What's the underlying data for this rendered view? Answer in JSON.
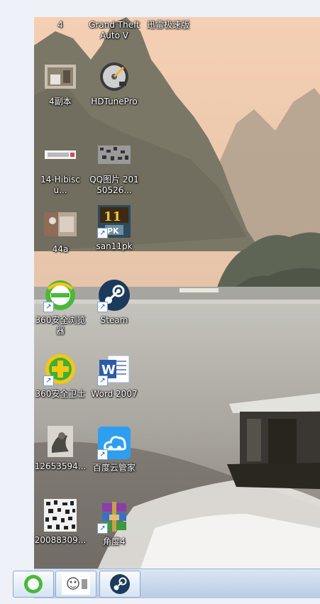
{
  "desktop": {
    "icons": [
      {
        "label": "4",
        "icon": "photo-icon"
      },
      {
        "label": "Grand Theft Auto V",
        "icon": "game-icon"
      },
      {
        "label": "迅雷极速版",
        "icon": "thunder-icon"
      },
      {
        "label": "4副本",
        "icon": "photo-icon"
      },
      {
        "label": "HDTunePro",
        "icon": "hard-disk-icon"
      },
      {
        "label": "14-Hibiscu...",
        "icon": "image-file-icon"
      },
      {
        "label": "QQ图片 20150526...",
        "icon": "image-file-icon"
      },
      {
        "label": "44a",
        "icon": "photo-icon"
      },
      {
        "label": "san11pk",
        "icon": "san11pk-icon"
      },
      {
        "label": "360安全浏览器",
        "icon": "browser-360-icon"
      },
      {
        "label": "Steam",
        "icon": "steam-icon"
      },
      {
        "label": "360安全卫士",
        "icon": "security-360-icon"
      },
      {
        "label": "Word 2007",
        "icon": "word-icon"
      },
      {
        "label": "12653594...",
        "icon": "photo-icon"
      },
      {
        "label": "百度云管家",
        "icon": "baidu-cloud-icon"
      },
      {
        "label": "20088309...",
        "icon": "image-file-icon"
      },
      {
        "label": "角度4",
        "icon": "winrar-icon"
      }
    ]
  },
  "taskbar": {
    "buttons": [
      {
        "icon": "browser-360-icon"
      },
      {
        "icon": "image-thumbnail-icon"
      },
      {
        "icon": "steam-icon"
      }
    ]
  },
  "colors": {
    "icon_label": "#ffffff",
    "taskbar": "#c9d9ec"
  }
}
